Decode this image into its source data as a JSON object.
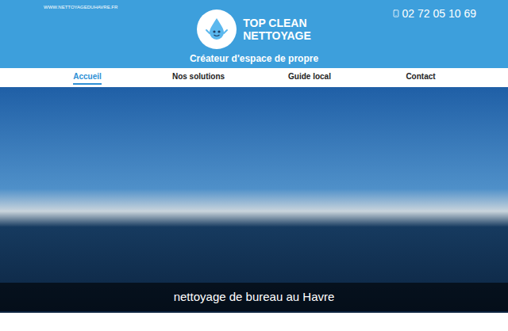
{
  "site_url": "WWW.NETTOYAGEDUHAVRE.FR",
  "brand": {
    "name_lines": [
      "TOP CLEAN",
      "NETTOYAGE"
    ],
    "tagline": "Créateur d'espace de propre"
  },
  "phone": "02 72 05 10 69",
  "nav": [
    {
      "label": "Accueil",
      "selected": true
    },
    {
      "label": "Nos solutions",
      "selected": false
    },
    {
      "label": "Guide local",
      "selected": false
    },
    {
      "label": "Contact",
      "selected": false
    }
  ],
  "hero": {
    "caption": "nettoyage de bureau au Havre"
  }
}
